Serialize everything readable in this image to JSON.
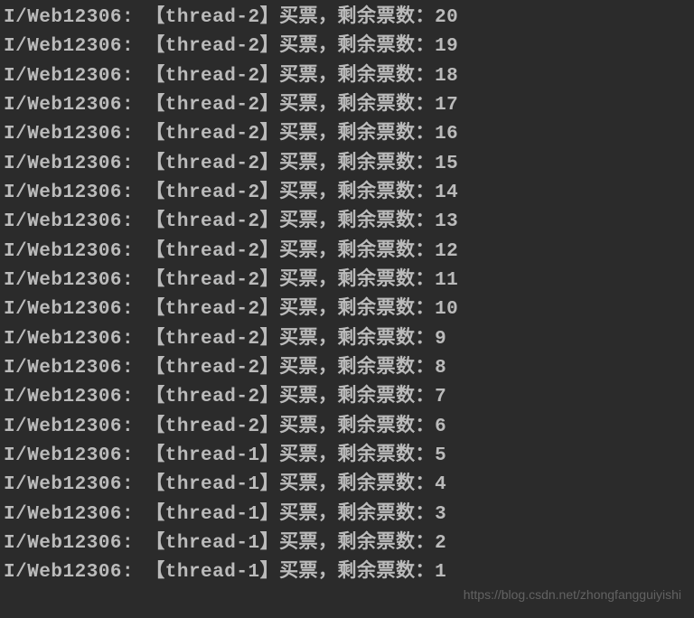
{
  "log": {
    "tag_prefix": "I/Web12306: ",
    "thread_open": "【",
    "thread_close": "】",
    "action_text": "买票，剩余票数：",
    "lines": [
      {
        "thread": "thread-2",
        "count": 20
      },
      {
        "thread": "thread-2",
        "count": 19
      },
      {
        "thread": "thread-2",
        "count": 18
      },
      {
        "thread": "thread-2",
        "count": 17
      },
      {
        "thread": "thread-2",
        "count": 16
      },
      {
        "thread": "thread-2",
        "count": 15
      },
      {
        "thread": "thread-2",
        "count": 14
      },
      {
        "thread": "thread-2",
        "count": 13
      },
      {
        "thread": "thread-2",
        "count": 12
      },
      {
        "thread": "thread-2",
        "count": 11
      },
      {
        "thread": "thread-2",
        "count": 10
      },
      {
        "thread": "thread-2",
        "count": 9
      },
      {
        "thread": "thread-2",
        "count": 8
      },
      {
        "thread": "thread-2",
        "count": 7
      },
      {
        "thread": "thread-2",
        "count": 6
      },
      {
        "thread": "thread-1",
        "count": 5
      },
      {
        "thread": "thread-1",
        "count": 4
      },
      {
        "thread": "thread-1",
        "count": 3
      },
      {
        "thread": "thread-1",
        "count": 2
      },
      {
        "thread": "thread-1",
        "count": 1
      }
    ]
  },
  "watermark": "https://blog.csdn.net/zhongfangguiyishi"
}
